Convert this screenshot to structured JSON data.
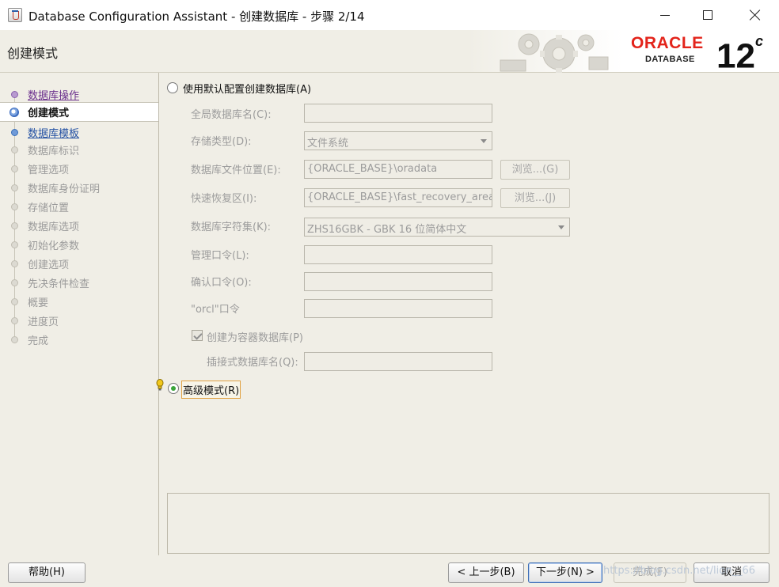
{
  "window": {
    "title": "Database Configuration Assistant - 创建数据库 - 步骤 2/14"
  },
  "header": {
    "page_title": "创建模式",
    "brand_name": "ORACLE",
    "brand_sub": "DATABASE",
    "brand_version": "12",
    "brand_version_suffix": "c"
  },
  "sidebar": {
    "steps": [
      {
        "label": "数据库操作",
        "state": "visited"
      },
      {
        "label": "创建模式",
        "state": "current"
      },
      {
        "label": "数据库模板",
        "state": "link"
      },
      {
        "label": "数据库标识",
        "state": "disabled"
      },
      {
        "label": "管理选项",
        "state": "disabled"
      },
      {
        "label": "数据库身份证明",
        "state": "disabled"
      },
      {
        "label": "存储位置",
        "state": "disabled"
      },
      {
        "label": "数据库选项",
        "state": "disabled"
      },
      {
        "label": "初始化参数",
        "state": "disabled"
      },
      {
        "label": "创建选项",
        "state": "disabled"
      },
      {
        "label": "先决条件检查",
        "state": "disabled"
      },
      {
        "label": "概要",
        "state": "disabled"
      },
      {
        "label": "进度页",
        "state": "disabled"
      },
      {
        "label": "完成",
        "state": "disabled"
      }
    ]
  },
  "form": {
    "default_mode_label": "使用默认配置创建数据库(A)",
    "global_db_name_label": "全局数据库名(C):",
    "global_db_name_value": "",
    "storage_type_label": "存储类型(D):",
    "storage_type_value": "文件系统",
    "db_file_location_label": "数据库文件位置(E):",
    "db_file_location_value": "{ORACLE_BASE}\\oradata",
    "browse_g_label": "浏览...(G)",
    "fast_recovery_label": "快速恢复区(I):",
    "fast_recovery_value": "{ORACLE_BASE}\\fast_recovery_area",
    "browse_j_label": "浏览...(J)",
    "charset_label": "数据库字符集(K):",
    "charset_value": "ZHS16GBK - GBK 16 位简体中文",
    "admin_password_label": "管理口令(L):",
    "confirm_password_label": "确认口令(O):",
    "orcl_password_label": "\"orcl\"口令",
    "container_db_label": "创建为容器数据库(P)",
    "container_db_checked": true,
    "pluggable_db_name_label": "插接式数据库名(Q):",
    "advanced_mode_label": "高级模式(R)",
    "selected_mode": "advanced"
  },
  "footer": {
    "help_label": "帮助(H)",
    "back_label": "< 上一步(B)",
    "next_label": "下一步(N) >",
    "finish_label": "完成(F)",
    "cancel_label": "取消",
    "watermark": "https://blog.csdn.net/lion__66"
  }
}
